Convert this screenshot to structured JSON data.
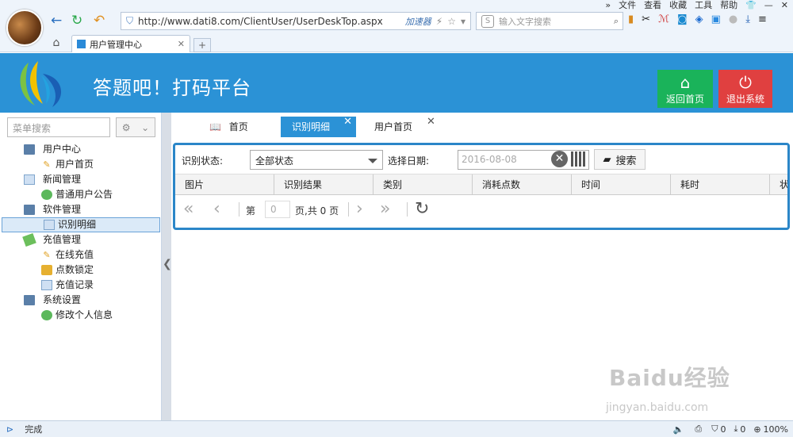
{
  "browser": {
    "menu": [
      "»",
      "文件",
      "查看",
      "收藏",
      "工具",
      "帮助"
    ],
    "url": "http://www.dati8.com/ClientUser/UserDeskTop.aspx",
    "accelerator": "加速器",
    "search_placeholder": "输入文字搜索",
    "tab_title": "用户管理中心",
    "status": "完成",
    "zoom": "100%",
    "counter_a": "0",
    "counter_b": "0"
  },
  "header": {
    "title": "答题吧！打码平台",
    "home_label": "返回首页",
    "exit_label": "退出系统"
  },
  "sidebar": {
    "search_placeholder": "菜单搜索",
    "groups": [
      {
        "label": "用户中心",
        "items": [
          "用户首页"
        ]
      },
      {
        "label": "新闻管理",
        "items": [
          "普通用户公告"
        ]
      },
      {
        "label": "软件管理",
        "items": [
          "识别明细"
        ]
      },
      {
        "label": "充值管理",
        "items": [
          "在线充值",
          "点数锁定",
          "充值记录"
        ]
      },
      {
        "label": "系统设置",
        "items": [
          "修改个人信息"
        ]
      }
    ]
  },
  "tabs": {
    "home": "首页",
    "detail": "识别明细",
    "user_home": "用户首页"
  },
  "filter": {
    "status_label": "识别状态:",
    "status_value": "全部状态",
    "date_label": "选择日期:",
    "date_value": "2016-08-08",
    "search_label": "搜索"
  },
  "grid": {
    "columns": [
      "图片",
      "识别结果",
      "类别",
      "消耗点数",
      "时间",
      "耗时",
      "状"
    ]
  },
  "pager": {
    "page_prefix": "第",
    "page_value": "0",
    "page_suffix": "页,共 0 页"
  },
  "watermark": {
    "brand": "Baidu经验",
    "site": "jingyan.baidu.com"
  }
}
